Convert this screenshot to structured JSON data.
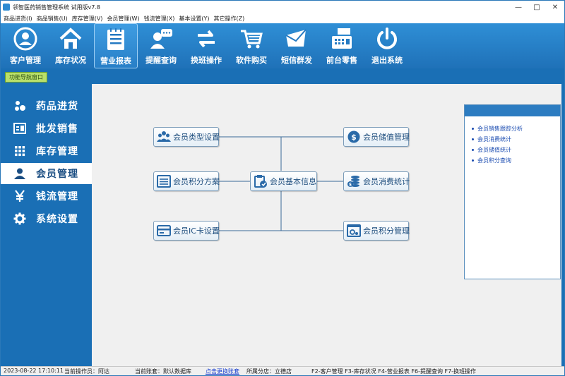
{
  "window": {
    "title": "领智医药销售管理系统 试用版v7.8",
    "controls": [
      "—",
      "□",
      "✕"
    ]
  },
  "menu": [
    "商品进货(I)",
    "商品销售(U)",
    "库存管理(V)",
    "会员管理(W)",
    "钱流管理(X)",
    "基本设置(Y)",
    "其它操作(Z)"
  ],
  "toolbar": [
    {
      "label": "客户管理",
      "icon": "customer-icon"
    },
    {
      "label": "库存状况",
      "icon": "home-icon"
    },
    {
      "label": "营业报表",
      "icon": "report-icon",
      "active": true
    },
    {
      "label": "提醒查询",
      "icon": "chat-user-icon"
    },
    {
      "label": "换班操作",
      "icon": "swap-icon"
    },
    {
      "label": "软件购买",
      "icon": "cart-icon"
    },
    {
      "label": "短信群发",
      "icon": "mail-icon"
    },
    {
      "label": "前台零售",
      "icon": "cash-register-icon"
    },
    {
      "label": "退出系统",
      "icon": "power-icon"
    }
  ],
  "nav_tab": {
    "label": "功能导航窗口"
  },
  "sidebar": [
    {
      "label": "药品进货",
      "icon": "pills-icon"
    },
    {
      "label": "批发销售",
      "icon": "ledger-icon"
    },
    {
      "label": "库存管理",
      "icon": "grid-icon"
    },
    {
      "label": "会员管理",
      "icon": "user-icon",
      "selected": true
    },
    {
      "label": "钱流管理",
      "icon": "yen-icon"
    },
    {
      "label": "系统设置",
      "icon": "gear-icon"
    }
  ],
  "diagram": {
    "center": {
      "label": "会员基本信息",
      "icon": "member-info-icon"
    },
    "left": [
      {
        "label": "会员类型设置",
        "icon": "people-icon"
      },
      {
        "label": "会员积分方案",
        "icon": "list-icon"
      },
      {
        "label": "会员IC卡设置",
        "icon": "card-icon"
      }
    ],
    "right": [
      {
        "label": "会员储值管理",
        "icon": "coin-icon"
      },
      {
        "label": "会员消费统计",
        "icon": "coins-stack-icon"
      },
      {
        "label": "会员积分管理",
        "icon": "settings-panel-icon"
      }
    ]
  },
  "quick_links": [
    "会员销售跟踪分析",
    "会员消费统计",
    "会员储值统计",
    "会员积分查询"
  ],
  "status": {
    "datetime": "2023-08-22  17:10:11",
    "operator": "当前操作员：阿达",
    "account": "当前账套：默认数据库",
    "switch_link": "点击更换账套",
    "branch": "所属分店：立德店",
    "shortcuts": "F2-客户管理  F3-库存状况  F4-营业报表  F6-提醒查询  F7-换班操作"
  },
  "colors": {
    "brand_blue": "#1a6fb5",
    "toolbar_top": "#2f8fd6",
    "link_blue": "#1a4bb0"
  }
}
